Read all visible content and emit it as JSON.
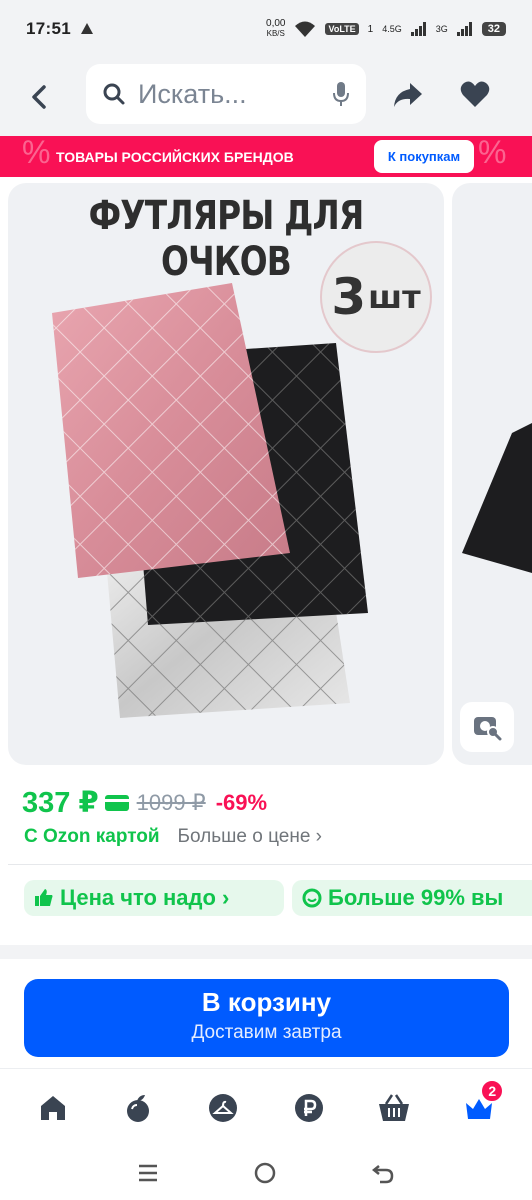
{
  "status_bar": {
    "time": "17:51",
    "net_speed_value": "0,00",
    "net_speed_unit": "KB/S",
    "volte": "VoLTE",
    "sim1": "1",
    "lte": "4.5G",
    "g3": "3G",
    "battery": "32"
  },
  "search": {
    "placeholder": "Искать..."
  },
  "banner": {
    "text": "ТОВАРЫ РОССИЙСКИХ БРЕНДОВ",
    "button": "К покупкам",
    "decor": "%"
  },
  "gallery": {
    "headline": "ФУТЛЯРЫ ДЛЯ ОЧКОВ",
    "badge_num": "3",
    "badge_unit": "шт"
  },
  "price": {
    "current": "337 ₽",
    "old": "1099 ₽",
    "discount": "-69%"
  },
  "ozon_card": {
    "label": "С Ozon картой",
    "more": "Больше о цене ›"
  },
  "chips": [
    {
      "label": "Цена что надо ›"
    },
    {
      "label": "Больше 99% вы"
    }
  ],
  "cart_button": {
    "title": "В корзину",
    "subtitle": "Доставим завтра"
  },
  "tab_bar": {
    "cart_count": "2"
  },
  "colors": {
    "accent": "#005bff",
    "price_green": "#10c44c",
    "discount_red": "#f91155"
  }
}
